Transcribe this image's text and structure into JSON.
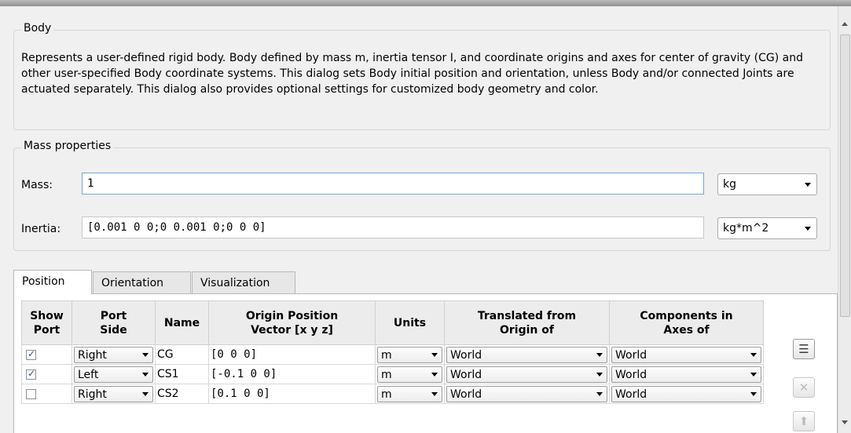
{
  "body_group": {
    "title": "Body",
    "description": "Represents a user-defined rigid body. Body defined by mass m, inertia tensor I, and coordinate origins and axes for center of gravity (CG) and other user-specified Body coordinate systems. This dialog sets Body initial position and orientation, unless Body and/or connected Joints are actuated separately. This dialog also provides optional settings for customized body geometry and color."
  },
  "mass_group": {
    "title": "Mass properties",
    "mass_label": "Mass:",
    "mass_value": "1",
    "mass_unit": "kg",
    "inertia_label": "Inertia:",
    "inertia_value": "[0.001 0 0;0 0.001 0;0 0 0]",
    "inertia_unit": "kg*m^2"
  },
  "tabs": [
    {
      "label": "Position",
      "active": true
    },
    {
      "label": "Orientation",
      "active": false
    },
    {
      "label": "Visualization",
      "active": false
    }
  ],
  "table": {
    "headers": {
      "show_port": [
        "Show",
        "Port"
      ],
      "port_side": [
        "Port",
        "Side"
      ],
      "name": [
        "Name"
      ],
      "origin": [
        "Origin Position",
        "Vector [x y z]"
      ],
      "units": [
        "Units"
      ],
      "translated": [
        "Translated from",
        "Origin of"
      ],
      "components": [
        "Components in",
        "Axes of"
      ]
    },
    "rows": [
      {
        "show": true,
        "checkmark": "✓",
        "side": "Right",
        "name": "CG",
        "origin": "[0 0 0]",
        "units": "m",
        "translated": "World",
        "components": "World"
      },
      {
        "show": true,
        "checkmark": "✓",
        "side": "Left",
        "name": "CS1",
        "origin": "[-0.1 0 0]",
        "units": "m",
        "translated": "World",
        "components": "World"
      },
      {
        "show": false,
        "checkmark": "",
        "side": "Right",
        "name": "CS2",
        "origin": "[0.1 0 0]",
        "units": "m",
        "translated": "World",
        "components": "World"
      }
    ]
  },
  "side_buttons": [
    {
      "icon": "add-row-icon",
      "glyph": "☰",
      "enabled": true
    },
    {
      "icon": "delete-icon",
      "glyph": "✕",
      "enabled": false
    },
    {
      "icon": "move-up-icon",
      "glyph": "⬆",
      "enabled": false
    }
  ]
}
